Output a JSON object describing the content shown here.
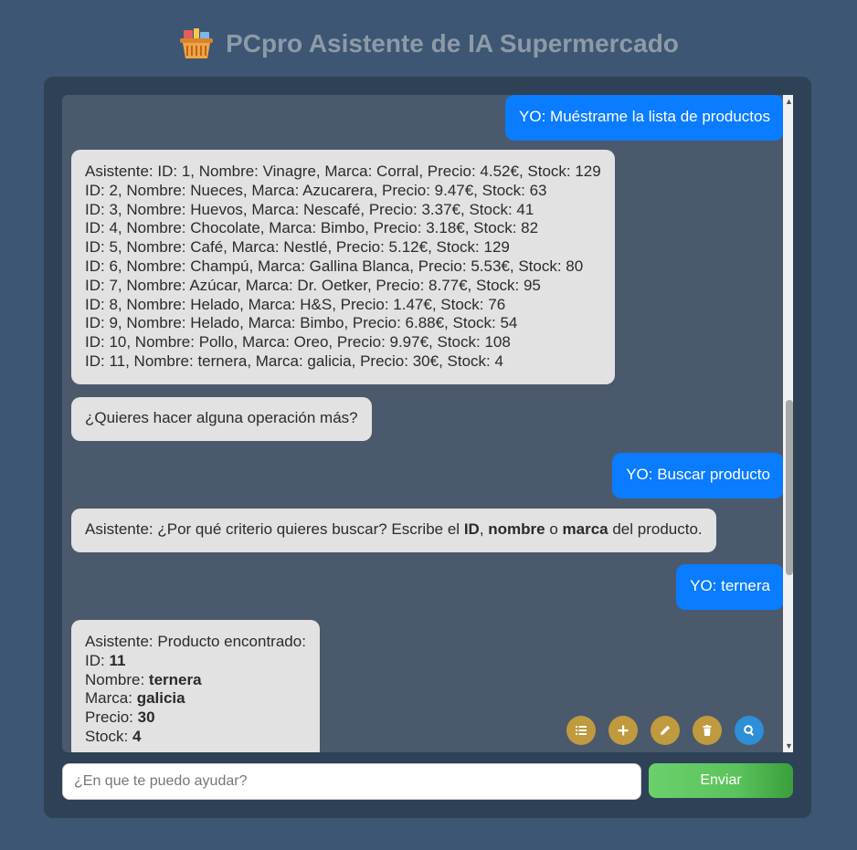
{
  "header": {
    "title": "PCpro Asistente de IA Supermercado",
    "icon": "shopping-basket-icon"
  },
  "chat": {
    "m1": "YO: Muéstrame la lista de productos",
    "m2": {
      "l1": "Asistente: ID: 1, Nombre: Vinagre, Marca: Corral, Precio: 4.52€, Stock: 129",
      "l2": "ID: 2, Nombre: Nueces, Marca: Azucarera, Precio: 9.47€, Stock: 63",
      "l3": "ID: 3, Nombre: Huevos, Marca: Nescafé, Precio: 3.37€, Stock: 41",
      "l4": "ID: 4, Nombre: Chocolate, Marca: Bimbo, Precio: 3.18€, Stock: 82",
      "l5": "ID: 5, Nombre: Café, Marca: Nestlé, Precio: 5.12€, Stock: 129",
      "l6": "ID: 6, Nombre: Champú, Marca: Gallina Blanca, Precio: 5.53€, Stock: 80",
      "l7": "ID: 7, Nombre: Azúcar, Marca: Dr. Oetker, Precio: 8.77€, Stock: 95",
      "l8": "ID: 8, Nombre: Helado, Marca: H&S, Precio: 1.47€, Stock: 76",
      "l9": "ID: 9, Nombre: Helado, Marca: Bimbo, Precio: 6.88€, Stock: 54",
      "l10": "ID: 10, Nombre: Pollo, Marca: Oreo, Precio: 9.97€, Stock: 108",
      "l11": "ID: 11, Nombre: ternera, Marca: galicia, Precio: 30€, Stock: 4"
    },
    "m3": "¿Quieres hacer alguna operación más?",
    "m4": "YO: Buscar producto",
    "m5": {
      "p1": "Asistente: ¿Por qué criterio quieres buscar? Escribe el ",
      "b1": "ID",
      "p2": ", ",
      "b2": "nombre",
      "p3": " o ",
      "b3": "marca",
      "p4": " del producto."
    },
    "m6": "YO: ternera",
    "m7": {
      "l1": "Asistente: Producto encontrado:",
      "id_label": "ID: ",
      "id_value": "11",
      "name_label": "Nombre: ",
      "name_value": "ternera",
      "brand_label": "Marca: ",
      "brand_value": "galicia",
      "price_label": "Precio: ",
      "price_value": "30",
      "stock_label": "Stock: ",
      "stock_value": "4"
    }
  },
  "actions": [
    {
      "name": "list-button",
      "icon": "list-icon"
    },
    {
      "name": "add-button",
      "icon": "plus-icon"
    },
    {
      "name": "edit-button",
      "icon": "pencil-icon"
    },
    {
      "name": "delete-button",
      "icon": "trash-icon"
    },
    {
      "name": "search-button",
      "icon": "search-icon"
    }
  ],
  "input": {
    "placeholder": "¿En que te puedo ayudar?",
    "value": ""
  },
  "send_label": "Enviar",
  "colors": {
    "background": "#3d5673",
    "panel": "#2e4157",
    "chat_area": "#4a5a6c",
    "user_bubble": "#0a7cff",
    "bot_bubble": "#e2e2e2",
    "action_gold": "#bf9a3e",
    "action_blue": "#2d8fd6",
    "send_green": "#5cc45c"
  }
}
